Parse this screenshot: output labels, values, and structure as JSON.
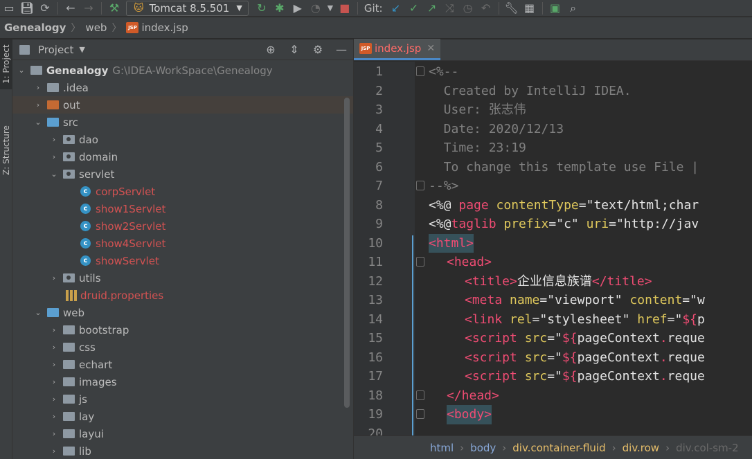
{
  "toolbar": {
    "run_config": "Tomcat 8.5.501",
    "git_label": "Git:"
  },
  "navbar": {
    "project": "Genealogy",
    "folder": "web",
    "file": "index.jsp",
    "file_badge": "JSP"
  },
  "side_tabs": {
    "project": "1: Project",
    "structure": "Z: Structure"
  },
  "project_panel": {
    "title": "Project",
    "root": {
      "name": "Genealogy",
      "path": "G:\\IDEA-WorkSpace\\Genealogy"
    },
    "items": [
      {
        "label": ".idea"
      },
      {
        "label": "out"
      },
      {
        "label": "src"
      },
      {
        "label": "dao"
      },
      {
        "label": "domain"
      },
      {
        "label": "servlet"
      },
      {
        "label": "corpServlet"
      },
      {
        "label": "show1Servlet"
      },
      {
        "label": "show2Servlet"
      },
      {
        "label": "show4Servlet"
      },
      {
        "label": "showServlet"
      },
      {
        "label": "utils"
      },
      {
        "label": "druid.properties"
      },
      {
        "label": "web"
      },
      {
        "label": "bootstrap"
      },
      {
        "label": "css"
      },
      {
        "label": "echart"
      },
      {
        "label": "images"
      },
      {
        "label": "js"
      },
      {
        "label": "lay"
      },
      {
        "label": "layui"
      },
      {
        "label": "lib"
      }
    ]
  },
  "editor": {
    "tab_label": "index.jsp",
    "tab_badge": "JSP",
    "line_numbers": [
      "1",
      "2",
      "3",
      "4",
      "5",
      "6",
      "7",
      "8",
      "9",
      "10",
      "11",
      "12",
      "13",
      "14",
      "15",
      "16",
      "17",
      "18",
      "19",
      "20"
    ],
    "code": {
      "l1": "<%--",
      "l2": "  Created by IntelliJ IDEA.",
      "l3": "  User: 张志伟",
      "l4": "  Date: 2020/12/13",
      "l5": "  Time: 23:19",
      "l6": "  To change this template use File |",
      "l7": "--%>",
      "l8a": "<%@ ",
      "l8b": "page ",
      "l8c": "contentType",
      "l8d": "=\"text/html;char",
      "l9a": "<%@",
      "l9b": "taglib ",
      "l9c": "prefix",
      "l9d": "=\"c\" ",
      "l9e": "uri",
      "l9f": "=\"http://jav",
      "l10": "<html>",
      "l11": "<head>",
      "l12a": "<title>",
      "l12b": "企业信息族谱",
      "l12c": "</title>",
      "l13a": "<meta ",
      "l13b": "name",
      "l13c": "=\"viewport\" ",
      "l13d": "content",
      "l13e": "=\"w",
      "l14a": "<link ",
      "l14b": "rel",
      "l14c": "=\"stylesheet\" ",
      "l14d": "href",
      "l14e": "=\"",
      "l14f": "${",
      "l14g": "p",
      "l15a": "<script ",
      "l15b": "src",
      "l15c": "=\"",
      "l15d": "${",
      "l15e": "pageContext",
      "l15f": ".",
      "l15g": "reque",
      "l16a": "<script ",
      "l16b": "src",
      "l16c": "=\"",
      "l16d": "${",
      "l16e": "pageContext",
      "l16f": ".",
      "l16g": "reque",
      "l17a": "<script ",
      "l17b": "src",
      "l17c": "=\"",
      "l17d": "${",
      "l17e": "pageContext",
      "l17f": ".",
      "l17g": "reque",
      "l18": "</head>",
      "l19": "<body>"
    },
    "breadcrumbs": [
      "html",
      "body",
      "div.container-fluid",
      "div.row",
      "div.col-sm-2"
    ]
  },
  "colors": {
    "background": "#2b2b2b",
    "panel": "#3c3f41",
    "accent_blue": "#4a88c7",
    "modified_red": "#d25252",
    "folder_orange": "#c46a33"
  }
}
